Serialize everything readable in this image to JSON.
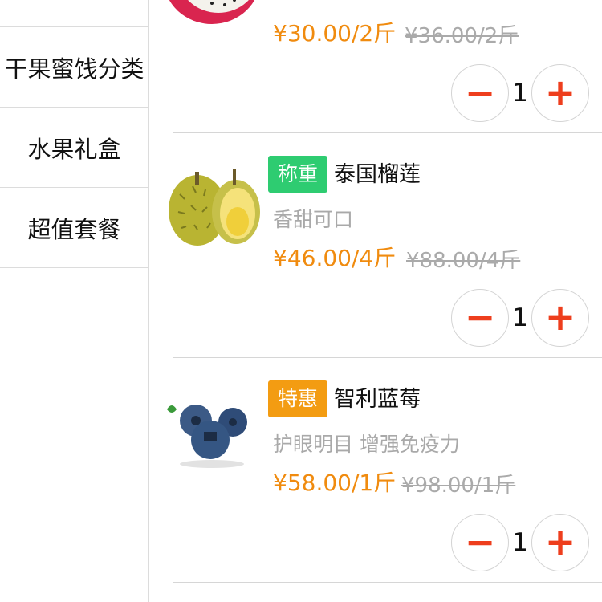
{
  "sidebar": {
    "categories": [
      {
        "label": ""
      },
      {
        "label": "干果蜜饯分类"
      },
      {
        "label": "水果礼盒"
      },
      {
        "label": "超值套餐"
      }
    ]
  },
  "products": [
    {
      "name": "",
      "badge": "",
      "desc": "",
      "price": "¥30.00/2斤",
      "old_price": "¥36.00/2斤",
      "quantity": "1",
      "image_icon": "dragon-fruit-image"
    },
    {
      "name": "泰国榴莲",
      "badge": "称重",
      "desc": "香甜可口",
      "price": "¥46.00/4斤",
      "old_price": "¥88.00/4斤",
      "quantity": "1",
      "image_icon": "durian-image"
    },
    {
      "name": "智利蓝莓",
      "badge": "特惠",
      "desc": "护眼明目 增强免疫力",
      "price": "¥58.00/1斤",
      "old_price": "¥98.00/1斤",
      "quantity": "1",
      "image_icon": "blueberry-image"
    }
  ],
  "stepper": {
    "minus_label": "−",
    "plus_label": "+"
  },
  "colors": {
    "accent_orange": "#f08b0f",
    "stepper_red": "#ee3e1d",
    "badge_green": "#2ecc71",
    "badge_orange": "#f39c12"
  }
}
